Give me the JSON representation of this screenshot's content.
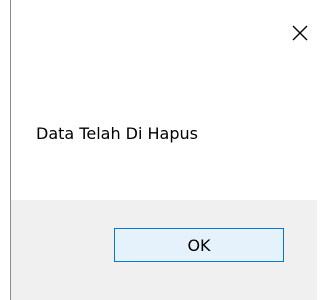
{
  "dialog": {
    "close_icon": "close-icon",
    "message": "Data Telah Di Hapus",
    "ok_label": "OK"
  },
  "colors": {
    "button_border": "#0078d7",
    "button_bg": "#e5f1fb",
    "footer_bg": "#f0f0f0"
  }
}
